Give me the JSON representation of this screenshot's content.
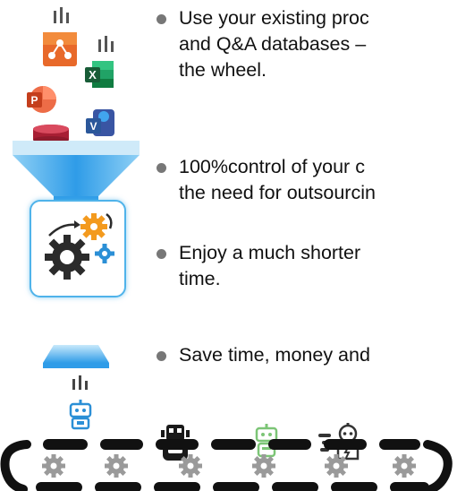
{
  "bullets": [
    {
      "lines": [
        "Use your existing proc",
        "and Q&A databases  –",
        "the wheel."
      ]
    },
    {
      "lines": [
        " 100%control of your c",
        "the need for outsourcin"
      ]
    },
    {
      "lines": [
        "Enjoy  a much shorter",
        "time."
      ]
    },
    {
      "lines": [
        "Save time, money and"
      ]
    }
  ],
  "app_icons": [
    "stream-icon",
    "office-app-icon",
    "excel-icon",
    "powerpoint-icon",
    "visio-icon",
    "database-icon"
  ],
  "robots": [
    "robot-blue-icon",
    "robot-black-icon",
    "robot-green-icon",
    "robot-speed-icon"
  ],
  "colors": {
    "funnel": "#2f9ce8",
    "funnel_light": "#8fd0f5",
    "process_box_border": "#4fb3ea",
    "gear_orange": "#f39a1e",
    "gear_blue": "#2b8fd6",
    "conveyor": "#111111",
    "cog_gray": "#9a9a9a"
  }
}
